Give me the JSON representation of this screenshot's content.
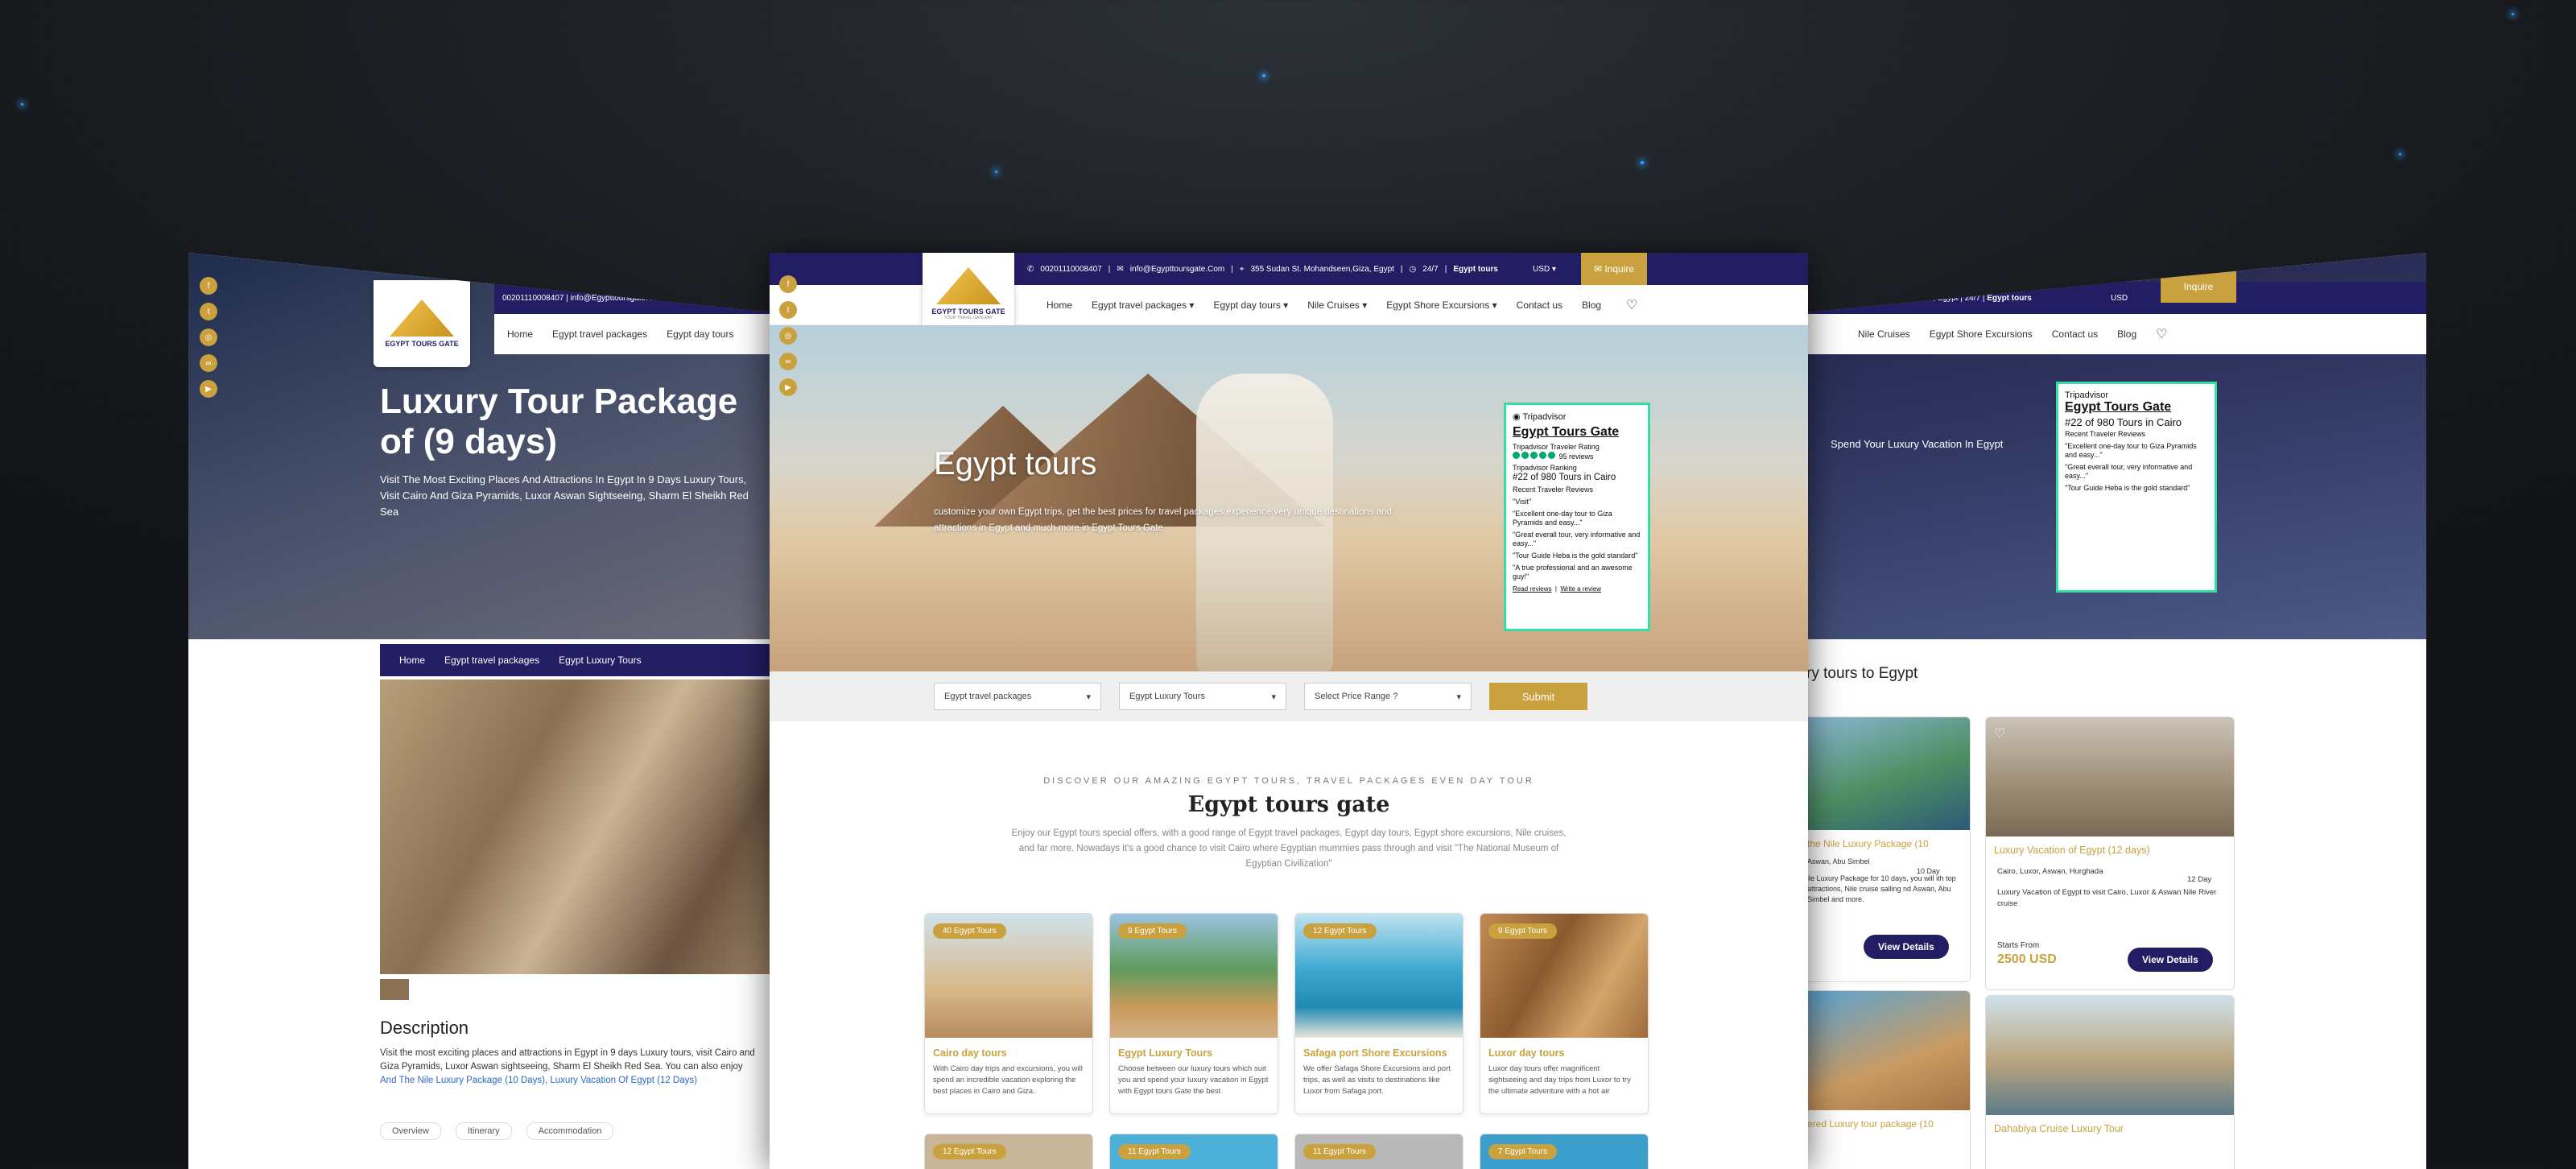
{
  "common": {
    "phone": "00201110008407",
    "email": "info@Egypttoursgate.Com",
    "address": "355 Sudan St. Mohandseen,Giza, Egypt",
    "hours": "24/7",
    "brand_short": "Egypt tours",
    "currency": "USD",
    "inquire": "Inquire",
    "logo": {
      "title": "EGYPT TOURS GATE",
      "sub": "YOUR TRAVEL GATEWAY"
    }
  },
  "nav": [
    "Home",
    "Egypt travel packages",
    "Egypt day tours",
    "Nile Cruises",
    "Egypt Shore Excursions",
    "Contact us",
    "Blog"
  ],
  "social_icons": [
    "facebook-icon",
    "twitter-icon",
    "instagram-icon",
    "tripadvisor-icon",
    "youtube-icon"
  ],
  "center": {
    "hero_title": "Egypt tours",
    "hero_sub": "customize your own Egypt trips, get the best prices for travel packages,experience very unique destinations and attractions in Egypt and much more in Egypt Tours Gate",
    "filters": [
      "Egypt travel packages",
      "Egypt Luxury Tours",
      "Select Price Range ?"
    ],
    "submit": "Submit",
    "kicker": "DISCOVER OUR AMAZING EGYPT TOURS, TRAVEL PACKAGES EVEN DAY TOUR",
    "heading": "Egypt tours gate",
    "intro": "Enjoy our Egypt tours special offers, with a good range of Egypt travel packages, Egypt day tours, Egypt shore excursions, Nile cruises, and far more. Nowadays it's a good chance to visit Cairo where Egyptian mummies pass through and visit \"The National Museum of Egyptian Civilization\"",
    "cards": [
      {
        "badge": "40 Egypt Tours",
        "title": "Cairo day tours",
        "desc": "With Cairo day trips and excursions, you will spend an incredible vacation exploring the best places in Cairo and Giza.",
        "color": "#c8a57a"
      },
      {
        "badge": "9 Egypt Tours",
        "title": "Egypt Luxury Tours",
        "desc": "Choose between our luxury tours which suit you and spend your luxury vacation in Egypt with Egypt tours Gate the best",
        "color": "#d49a5a"
      },
      {
        "badge": "12 Egypt Tours",
        "title": "Safaga port Shore Excursions",
        "desc": "We offer Safaga Shore Excursions and port trips, as well as visits to destinations like Luxor from Safaga port.",
        "color": "#3fa7cf"
      },
      {
        "badge": "9 Egypt Tours",
        "title": "Luxor day tours",
        "desc": "Luxor day tours offer magnificent sightseeing and day trips from Luxor to try the ultimate adventure with a hot air",
        "color": "#b07a42"
      }
    ],
    "cards_row2": [
      "12 Egypt Tours",
      "11 Egypt Tours",
      "11 Egypt Tours",
      "7 Egypt Tours"
    ]
  },
  "tripadvisor": {
    "brand": "Tripadvisor",
    "name": "Egypt Tours Gate",
    "rating_label": "Tripadvisor Traveler Rating",
    "reviews": "95 reviews",
    "ranking_label": "Tripadvisor Ranking",
    "ranking": "#22 of 980 Tours in Cairo",
    "recent_label": "Recent Traveler Reviews",
    "quotes": [
      "\"Visit\"",
      "\"Excellent one-day tour to Giza Pyramids and easy...\"",
      "\"Great everall tour, very informative and easy...\"",
      "\"Tour Guide Heba is the gold standard\"",
      "\"A true professional and an awesome guy!\""
    ],
    "read": "Read reviews",
    "write": "Write a review"
  },
  "left": {
    "title": "Luxury Tour Package of (9 days)",
    "subtitle": "Visit The Most Exciting Places And Attractions In Egypt In 9 Days Luxury Tours, Visit Cairo And Giza Pyramids, Luxor Aswan Sightseeing, Sharm El Sheikh Red Sea",
    "breadcrumb": [
      "Home",
      "Egypt travel packages",
      "Egypt Luxury Tours"
    ],
    "desc_heading": "Description",
    "desc_text": "Visit the most exciting places and attractions in Egypt in 9 days Luxury tours, visit Cairo and Giza Pyramids, Luxor Aswan sightseeing, Sharm El Sheikh Red Sea. You can also enjoy",
    "link1": "And The Nile Luxury Package (10 Days)",
    "link2": "Luxury Vacation Of Egypt (12 Days)",
    "tabs": [
      "Overview",
      "Itinerary",
      "Accommodation"
    ]
  },
  "right": {
    "hero_sub": "Spend Your Luxury Vacation In Egypt",
    "section": "ry tours to Egypt",
    "c1_title": "the Nile Luxury Package (10",
    "c1_loc": "Aswan, Abu Simbel",
    "c1_days": "10 Day",
    "c1_desc": "ile Luxury Package for 10 days, you will ith top attractions, Nile cruise sailing nd Aswan, Abu Simbel and more.",
    "c2_title": "Luxury Vacation of Egypt (12 days)",
    "c2_loc": "Cairo, Luxor, Aswan, Hurghada",
    "c2_days": "12 Day",
    "c2_desc": "Luxury Vacation of Egypt to visit Cairo, Luxor & Aswan Nile River cruise",
    "starts": "Starts From",
    "price": "2500 USD",
    "view": "View Details",
    "c3_title": "ered Luxury tour package (10",
    "c4_title": "Dahabiya Cruise Luxury Tour"
  }
}
